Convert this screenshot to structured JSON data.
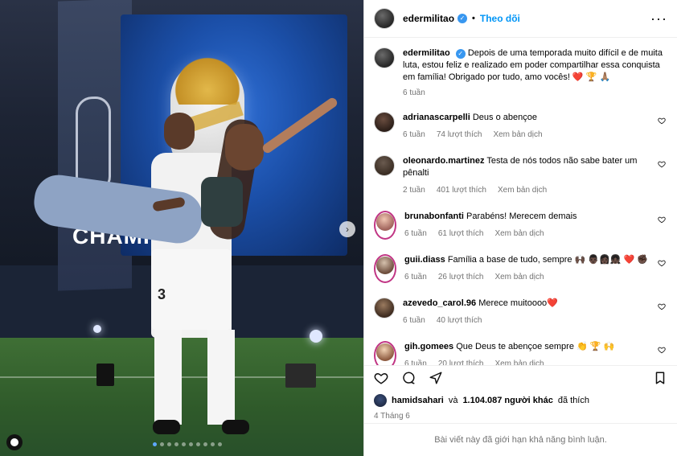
{
  "post": {
    "author": {
      "username": "edermilitao",
      "follow_label": "Theo dõi"
    },
    "caption": {
      "text": "Depois de uma temporada muito difícil e de muita luta, estou feliz e realizado em poder compartilhar essa conquista em família! Obrigado por tudo, amo vocês! ❤️ 🏆 🙏🏽",
      "time": "6 tuần"
    },
    "comments": [
      {
        "username": "adrianascarpelli",
        "text": "Deus o abençoe",
        "time": "6 tuần",
        "likes": "74 lượt thích",
        "translate": "Xem bản dịch"
      },
      {
        "username": "oleonardo.martinez",
        "text": "Testa de nós todos não sabe bater um pênalti",
        "time": "2 tuần",
        "likes": "401 lượt thích",
        "translate": "Xem bản dịch"
      },
      {
        "username": "brunabonfanti",
        "text": "Parabéns! Merecem demais",
        "time": "6 tuần",
        "likes": "61 lượt thích",
        "translate": "Xem bản dịch"
      },
      {
        "username": "guii.diass",
        "text": "Família a base de tudo, sempre 🙌🏿 👨🏿‍👩🏿‍👧🏿 ❤️ ✊🏿",
        "time": "6 tuần",
        "likes": "26 lượt thích",
        "translate": "Xem bản dịch"
      },
      {
        "username": "azevedo_carol.96",
        "text": "Merece muitoooo❤️",
        "time": "6 tuần",
        "likes": "40 lượt thích",
        "translate": ""
      },
      {
        "username": "gih.gomees",
        "text": "Que Deus te abençoe sempre 👏 🏆 🙌",
        "time": "6 tuần",
        "likes": "20 lượt thích",
        "translate": "Xem bản dịch"
      }
    ],
    "likes_summary": {
      "user": "hamidsahari",
      "connector": "và",
      "count": "1.104.087 người khác",
      "suffix": "đã thích"
    },
    "date": "4 Tháng 6",
    "comments_limited": "Bài viết này đã giới hạn khả năng bình luận."
  },
  "media": {
    "carousel_index": 1,
    "carousel_count": 10,
    "banner_text": "CHAMP"
  },
  "icons": {
    "verified": "verified-badge-icon",
    "more": "more-horizontal-icon",
    "like": "heart-icon",
    "comment": "comment-icon",
    "share": "share-icon",
    "save": "bookmark-icon",
    "next": "chevron-right-icon",
    "tag": "user-tag-icon"
  },
  "colors": {
    "follow": "#0095f6",
    "verified": "#3897f0",
    "muted": "#737373",
    "border": "#dbdbdb"
  }
}
